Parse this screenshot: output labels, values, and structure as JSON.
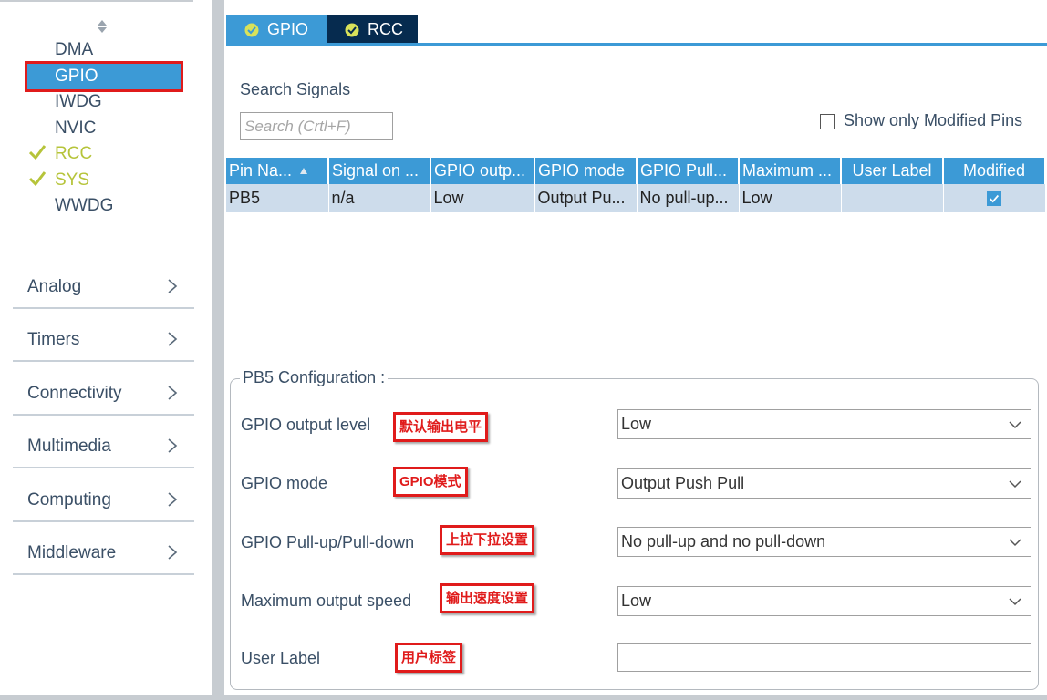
{
  "sidebar": {
    "components": [
      {
        "label": "DMA",
        "status": "none",
        "selected": false
      },
      {
        "label": "GPIO",
        "status": "none",
        "selected": true
      },
      {
        "label": "IWDG",
        "status": "none",
        "selected": false
      },
      {
        "label": "NVIC",
        "status": "none",
        "selected": false
      },
      {
        "label": "RCC",
        "status": "ok",
        "selected": false
      },
      {
        "label": "SYS",
        "status": "ok",
        "selected": false
      },
      {
        "label": "WWDG",
        "status": "none",
        "selected": false
      }
    ],
    "categories": [
      "Analog",
      "Timers",
      "Connectivity",
      "Multimedia",
      "Computing",
      "Middleware"
    ]
  },
  "tabs": [
    {
      "label": "GPIO",
      "active": true,
      "icon": "check-circle-icon"
    },
    {
      "label": "RCC",
      "active": false,
      "icon": "check-circle-icon"
    }
  ],
  "search": {
    "title": "Search Signals",
    "placeholder": "Search (Crtl+F)",
    "show_modified_label": "Show only Modified Pins",
    "show_modified_checked": false
  },
  "table": {
    "headers": [
      "Pin Na...",
      "Signal on ...",
      "GPIO outp...",
      "GPIO mode",
      "GPIO Pull...",
      "Maximum ...",
      "User Label",
      "Modified"
    ],
    "rows": [
      {
        "pin": "PB5",
        "signal": "n/a",
        "output": "Low",
        "mode": "Output Pu...",
        "pull": "No pull-up...",
        "speed": "Low",
        "user_label": "",
        "modified": true
      }
    ]
  },
  "config": {
    "title": "PB5 Configuration :",
    "fields": [
      {
        "label": "GPIO output level",
        "annotation": "默认输出电平",
        "value": "Low"
      },
      {
        "label": "GPIO mode",
        "annotation": "GPIO模式",
        "value": "Output Push Pull"
      },
      {
        "label": "GPIO Pull-up/Pull-down",
        "annotation": "上拉下拉设置",
        "value": "No pull-up and no pull-down"
      },
      {
        "label": "Maximum output speed",
        "annotation": "输出速度设置",
        "value": "Low"
      },
      {
        "label": "User Label",
        "annotation": "用户标签",
        "value": ""
      }
    ]
  },
  "colors": {
    "accent": "#3c9ad6",
    "tab_dark": "#062b4f",
    "ok_green": "#b6c43a",
    "annotation_red": "#e01b1b",
    "row_bg": "#cddceb"
  }
}
